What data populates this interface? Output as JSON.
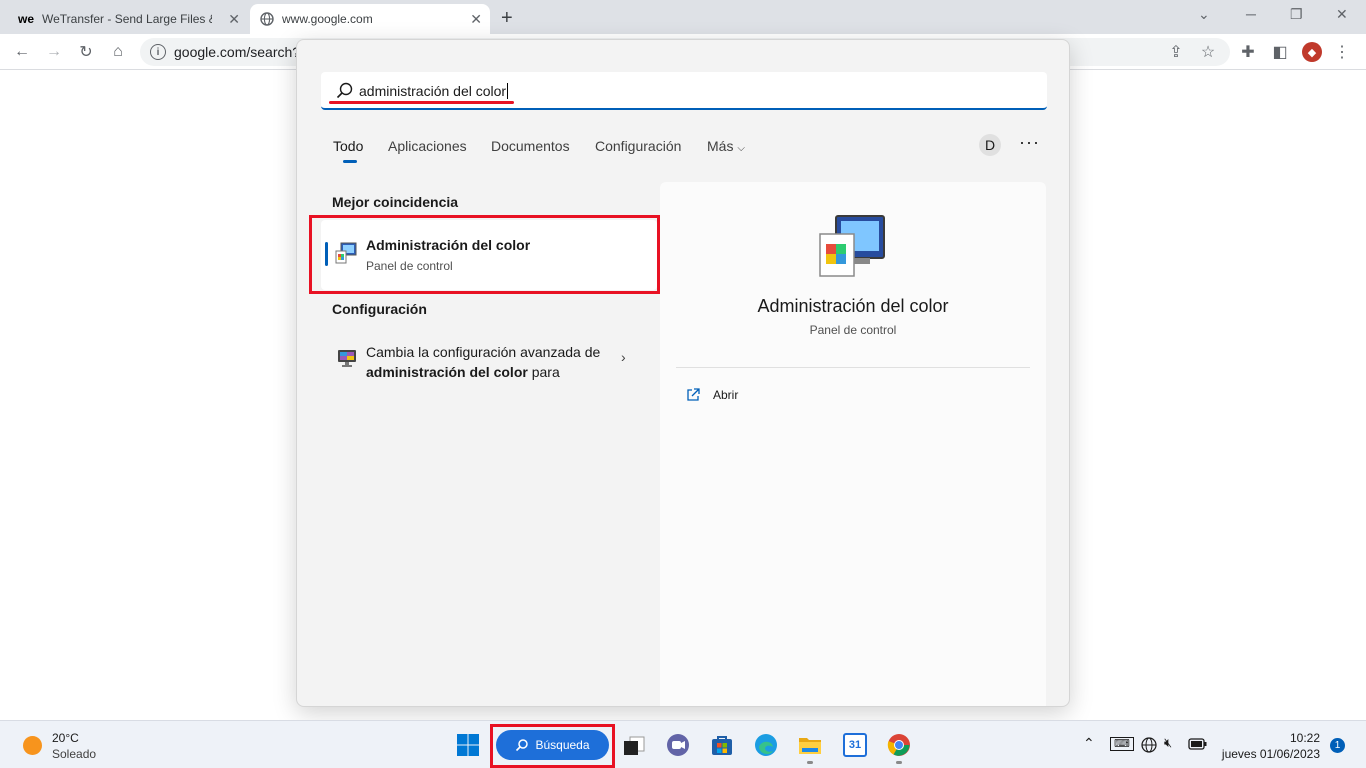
{
  "browser": {
    "tabs": [
      {
        "label": "WeTransfer - Send Large Files & Share",
        "icon": "wetransfer-icon"
      },
      {
        "label": "www.google.com",
        "icon": "globe-icon"
      }
    ],
    "new_tab": "+",
    "address": "google.com/search?",
    "profile_color": "#c0392b"
  },
  "search_panel": {
    "query": "administración del color",
    "tabs": [
      "Todo",
      "Aplicaciones",
      "Documentos",
      "Configuración",
      "Más"
    ],
    "active_tab": "Todo",
    "avatar_letter": "D",
    "more": "···",
    "best_match_title": "Mejor coincidencia",
    "best_match": {
      "title": "Administración del color",
      "subtitle": "Panel de control"
    },
    "settings_title": "Configuración",
    "setting_item": {
      "prefix": "Cambia la configuración avanzada de ",
      "bold": "administración del color",
      "suffix": " para"
    },
    "detail": {
      "title": "Administración del color",
      "subtitle": "Panel de control",
      "open_label": "Abrir"
    },
    "accent_color": "#005fb8",
    "highlight_color": "#e81123"
  },
  "taskbar": {
    "weather_temp": "20°C",
    "weather_condition": "Soleado",
    "search_label": "Búsqueda",
    "time": "10:22",
    "date": "jueves 01/06/2023",
    "notification_count": "1",
    "apps": [
      "start-icon",
      "task-view-icon",
      "chat-icon",
      "store-icon",
      "edge-icon",
      "file-explorer-icon",
      "calendar-icon",
      "chrome-icon"
    ],
    "calendar_day": "31"
  }
}
